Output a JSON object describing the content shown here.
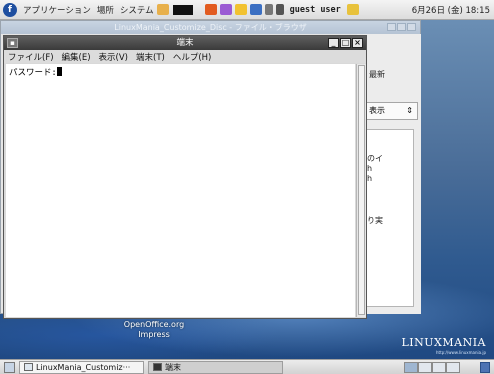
{
  "top_panel": {
    "applications": "アプリケーション",
    "places": "場所",
    "system": "システム",
    "user": "guest user",
    "clock": "6月26日 (金) 18:15"
  },
  "file_browser": {
    "title": "LinuxMania_Customize_Disc - ファイル・ブラウザ",
    "reload_label": "最新",
    "view_select": "表示",
    "pane_text_1": "のイ",
    "pane_text_2": "h",
    "pane_text_3": "h",
    "pane_text_4": "り実"
  },
  "terminal": {
    "title": "端末",
    "menu": [
      "ファイル(F)",
      "編集(E)",
      "表示(V)",
      "端末(T)",
      "ヘルプ(H)"
    ],
    "prompt": "パスワード:"
  },
  "desktop": {
    "icon_label_1": "OpenOffice.org",
    "icon_label_2": "Impress",
    "brand": "LINUXMANIA",
    "brand_url": "http://www.linuxmania.jp"
  },
  "bottom_panel": {
    "task_file_browser": "LinuxMania_Customiz···",
    "task_terminal": "端末"
  }
}
